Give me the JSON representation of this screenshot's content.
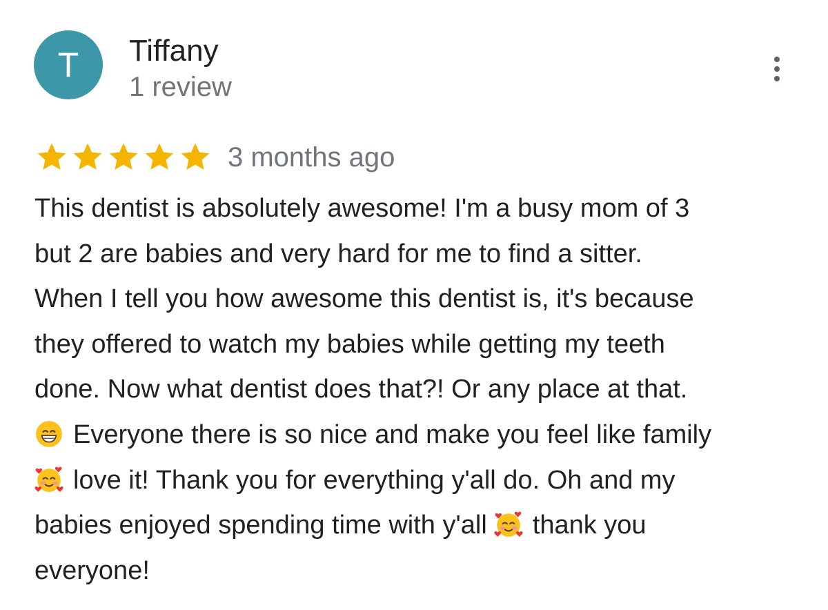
{
  "reviewer": {
    "initial": "T",
    "name": "Tiffany",
    "review_count": "1 review",
    "avatar_color": "#3c98a8"
  },
  "menu": {
    "icon": "more-vert-icon"
  },
  "rating": {
    "stars": 5,
    "max_stars": 5,
    "star_color": "#f4b400",
    "timestamp": "3 months ago"
  },
  "review": {
    "lines": [
      "This dentist is absolutely awesome! I'm a busy mom of 3",
      "but 2 are babies and very hard for me to find a sitter.",
      "When I tell you how awesome this dentist is, it's because",
      "they offered to watch my babies while getting my teeth",
      "done. Now what dentist does that?! Or any place at that.",
      "Everyone there is so nice and make you feel like family",
      "love it! Thank you for everything y'all do. Oh and my",
      "babies enjoyed spending time with y'all",
      "thank you",
      "everyone!"
    ],
    "emojis": [
      "grinning-face-emoji",
      "smiling-face-with-hearts-emoji",
      "smiling-face-with-hearts-emoji"
    ]
  }
}
